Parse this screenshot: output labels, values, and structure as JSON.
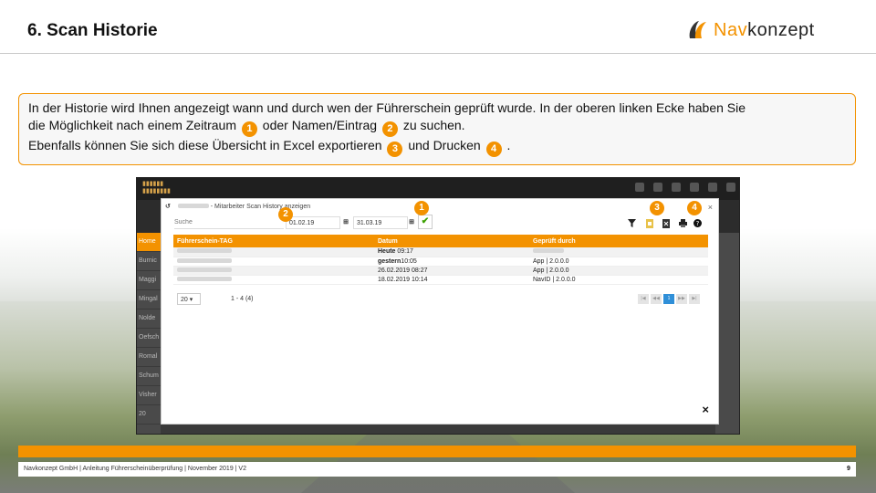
{
  "slide": {
    "title": "6. Scan Historie",
    "logo_prefix": "Nav",
    "logo_suffix": "konzept",
    "accent_color": "#f39200"
  },
  "info": {
    "line1": "In der Historie wird Ihnen angezeigt wann und durch wen der Führerschein geprüft wurde. In der oberen linken Ecke haben Sie",
    "line2_a": "die Möglichkeit nach einem Zeitraum",
    "badge1": "1",
    "line2_b": "oder Namen/Eintrag",
    "badge2": "2",
    "line2_c": "zu suchen.",
    "line3_a": "Ebenfalls können Sie sich diese Übersicht in Excel exportieren",
    "badge3": "3",
    "line3_b": "und Drucken",
    "badge4": "4",
    "line3_c": "."
  },
  "app": {
    "side_items": [
      "Home",
      "Burnic",
      "Maggi",
      "Mingal",
      "Nolde",
      "Oefsch",
      "Romal",
      "Schum",
      "Visher",
      "20"
    ]
  },
  "modal": {
    "title": "- Mitarbeiter Scan History anzeigen",
    "close": "×",
    "search_placeholder": "Suche",
    "date_from": "01.02.19",
    "date_to": "31.03.19",
    "date_icon": "⊞",
    "confirm_icon": "✔",
    "columns": [
      "Führerschein-TAG",
      "Datum",
      "Geprüft durch"
    ],
    "rows": [
      {
        "datum_bold": "Heute",
        "datum_rest": " 09:17",
        "geprueft": ""
      },
      {
        "datum_bold": "gestern",
        "datum_rest": "10:05",
        "geprueft": "App | 2.0.0.0"
      },
      {
        "datum_bold": "",
        "datum_rest": "26.02.2019 08:27",
        "geprueft": "App | 2.0.0.0"
      },
      {
        "datum_bold": "",
        "datum_rest": "18.02.2019 10:14",
        "geprueft": "NavID | 2.0.0.0"
      }
    ],
    "page_size": "20",
    "page_info": "1 - 4 (4)",
    "pager": [
      "|◀",
      "◀◀",
      "1",
      "▶▶",
      "▶|"
    ],
    "close_bottom": "×",
    "shot_badges": [
      "1",
      "2",
      "3",
      "4"
    ]
  },
  "footer": {
    "text": "Navkonzept GmbH  |  Anleitung Führerscheinüberprüfung  |  November 2019  |  V2",
    "page_number": "9"
  }
}
